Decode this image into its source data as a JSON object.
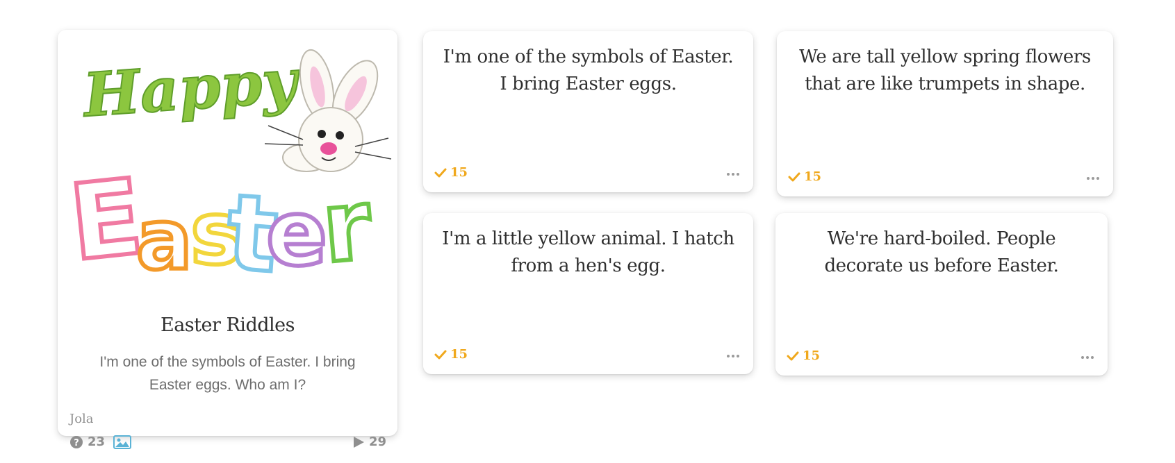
{
  "quiz": {
    "title": "Easter Riddles",
    "description": "I'm one of the symbols of Easter. I bring Easter eggs. Who am I?",
    "author": "Jola",
    "question_count": "23",
    "play_count": "29",
    "cover_image": {
      "lettering_line1": "Happy",
      "lettering_line2": "Easter",
      "depicts": "bunny"
    },
    "icons": {
      "questions": "question-circle-icon",
      "image": "image-icon",
      "plays": "play-icon"
    }
  },
  "riddles": [
    {
      "text": "I'm one of the symbols of Easter. I bring Easter eggs.",
      "points": "15"
    },
    {
      "text": "We are tall yellow spring flowers that are like trumpets in shape.",
      "points": "15"
    },
    {
      "text": "I'm a little yellow animal. I hatch from a hen's egg.",
      "points": "15"
    },
    {
      "text": "We're hard-boiled. People decorate us before Easter.",
      "points": "15"
    }
  ],
  "colors": {
    "accent": "#f0a81c",
    "text": "#2f2f2f",
    "muted": "#8f8f8f",
    "image_icon": "#5bb3d6"
  }
}
